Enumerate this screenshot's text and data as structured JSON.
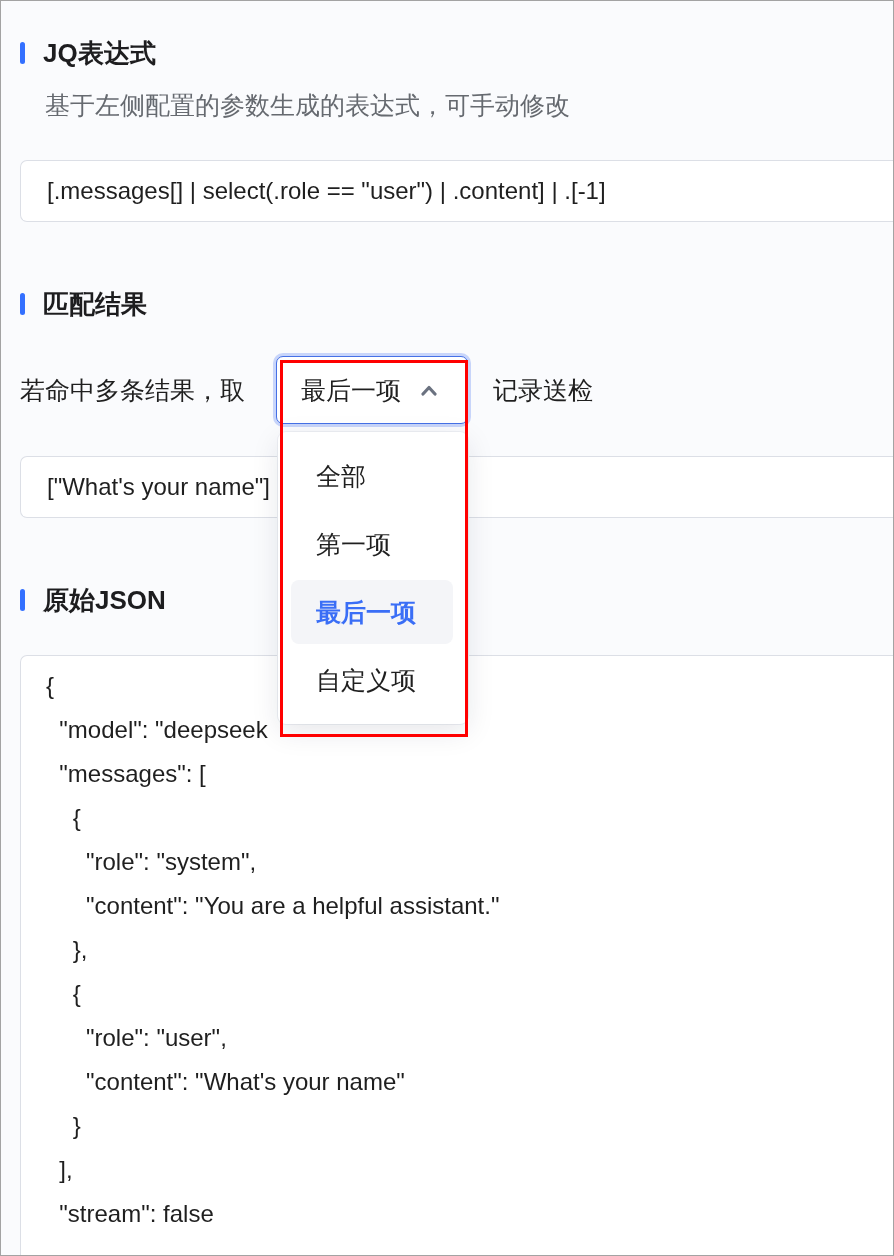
{
  "jq_expression": {
    "title": "JQ表达式",
    "description": "基于左侧配置的参数生成的表达式，可手动修改",
    "value": "[.messages[] | select(.role == \"user\") | .content] | .[-1]"
  },
  "match_result": {
    "title": "匹配结果",
    "prefix": "若命中多条结果，取",
    "select": {
      "value": "最后一项",
      "focused": true,
      "expanded": true,
      "highlighted": true,
      "options": [
        {
          "label": "全部",
          "selected": false
        },
        {
          "label": "第一项",
          "selected": false
        },
        {
          "label": "最后一项",
          "selected": true
        },
        {
          "label": "自定义项",
          "selected": false
        }
      ]
    },
    "suffix": "记录送检",
    "result": "[\"What's your name\"]"
  },
  "raw_json": {
    "title": "原始JSON",
    "lines": [
      "{",
      "  \"model\": \"deepseek",
      "  \"messages\": [",
      "    {",
      "      \"role\": \"system\",",
      "      \"content\": \"You are a helpful assistant.\"",
      "    },",
      "    {",
      "      \"role\": \"user\",",
      "      \"content\": \"What's your name\"",
      "    }",
      "  ],",
      "  \"stream\": false"
    ]
  }
}
